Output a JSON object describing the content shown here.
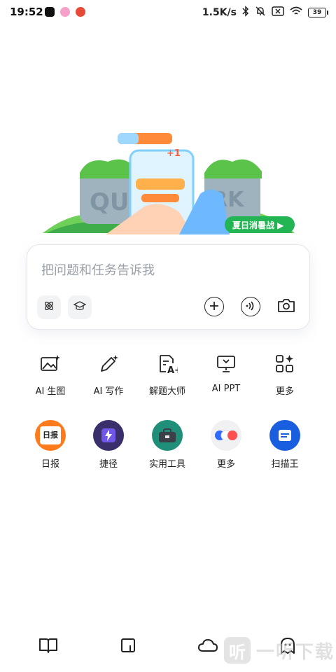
{
  "status_bar": {
    "time": "19:52",
    "network_speed": "1.5K/s",
    "battery": "39"
  },
  "banner": {
    "letters_left": "QU",
    "letters_right": "RK",
    "badge_label": "夏日消暑战 ▶",
    "plus_label": "+1"
  },
  "input_card": {
    "placeholder": "把问题和任务告诉我"
  },
  "tools": [
    {
      "label": "AI 生图",
      "icon": "image-sparkle-icon"
    },
    {
      "label": "AI 写作",
      "icon": "pen-sparkle-icon"
    },
    {
      "label": "解题大师",
      "icon": "doc-grade-icon"
    },
    {
      "label": "AI PPT",
      "icon": "presentation-icon"
    },
    {
      "label": "更多",
      "icon": "grid-sparkle-icon"
    }
  ],
  "apps": [
    {
      "label": "日报",
      "icon_text": "日报",
      "color": "#ff7a1a"
    },
    {
      "label": "捷径",
      "icon_text": "",
      "color": "#3a2f6b"
    },
    {
      "label": "实用工具",
      "icon_text": "",
      "color": "#1f8f7a"
    },
    {
      "label": "更多",
      "icon_text": "",
      "color": "#f1f1f4"
    },
    {
      "label": "扫描王",
      "icon_text": "",
      "color": "#1a5ee0"
    }
  ],
  "bottom_nav": [
    {
      "name": "book-icon"
    },
    {
      "name": "note-icon"
    },
    {
      "name": "cloud-icon"
    },
    {
      "name": "ghost-icon"
    }
  ],
  "watermark": {
    "box": "听",
    "text": "一听下载"
  },
  "colors": {
    "accent_green": "#4cc35a",
    "badge_green": "#23b553",
    "card_border": "#e6e6ea"
  }
}
